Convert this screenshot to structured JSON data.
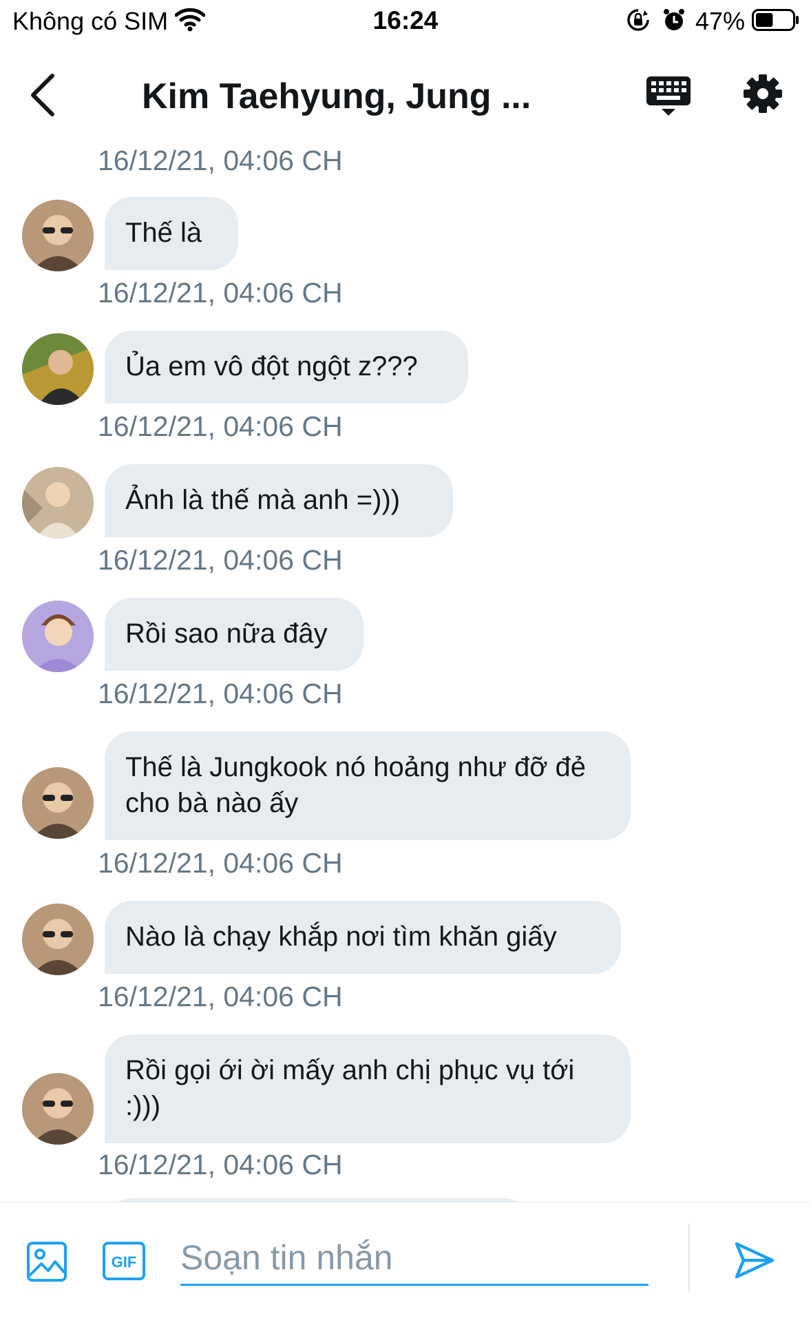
{
  "status_bar": {
    "carrier": "Không có SIM",
    "time": "16:24",
    "battery": "47%",
    "battery_level": 0.47
  },
  "header": {
    "title": "Kim Taehyung, Jung ...",
    "back_icon": "chevron-left-icon",
    "keyboard_icon": "keyboard-icon",
    "settings_icon": "gear-icon"
  },
  "messages": [
    {
      "timestamp": "16/12/21, 04:06 CH",
      "text": "Thế là",
      "avatar_color": "#b89878"
    },
    {
      "timestamp": "16/12/21, 04:06 CH",
      "text": "Ủa em vô đột ngột z???",
      "avatar_color": "#6d8a3a"
    },
    {
      "timestamp": "16/12/21, 04:06 CH",
      "text": "Ảnh là thế mà anh =)))",
      "avatar_color": "#c9b59a"
    },
    {
      "timestamp": "16/12/21, 04:06 CH",
      "text": "Rồi sao nữa đây",
      "avatar_color": "#b6a6e0"
    },
    {
      "timestamp": "16/12/21, 04:06 CH",
      "text": "Thế là Jungkook nó hoảng như đỡ đẻ cho bà nào ấy",
      "avatar_color": "#b89878"
    },
    {
      "timestamp": "16/12/21, 04:06 CH",
      "text": "Nào là chạy khắp nơi tìm khăn giấy",
      "avatar_color": "#b89878"
    },
    {
      "timestamp": "16/12/21, 04:06 CH",
      "text": "Rồi gọi ới ời mấy anh chị phục vụ tới :)))",
      "avatar_color": "#b89878"
    },
    {
      "timestamp": "16/12/21, 04:06 CH"
    }
  ],
  "composer": {
    "placeholder": "Soạn tin nhắn",
    "image_icon": "image-icon",
    "gif_label": "GIF",
    "send_icon": "send-icon"
  },
  "colors": {
    "accent": "#1da1f2",
    "bubble": "#e6ecf0",
    "timestamp": "#657786",
    "text": "#14171a"
  }
}
